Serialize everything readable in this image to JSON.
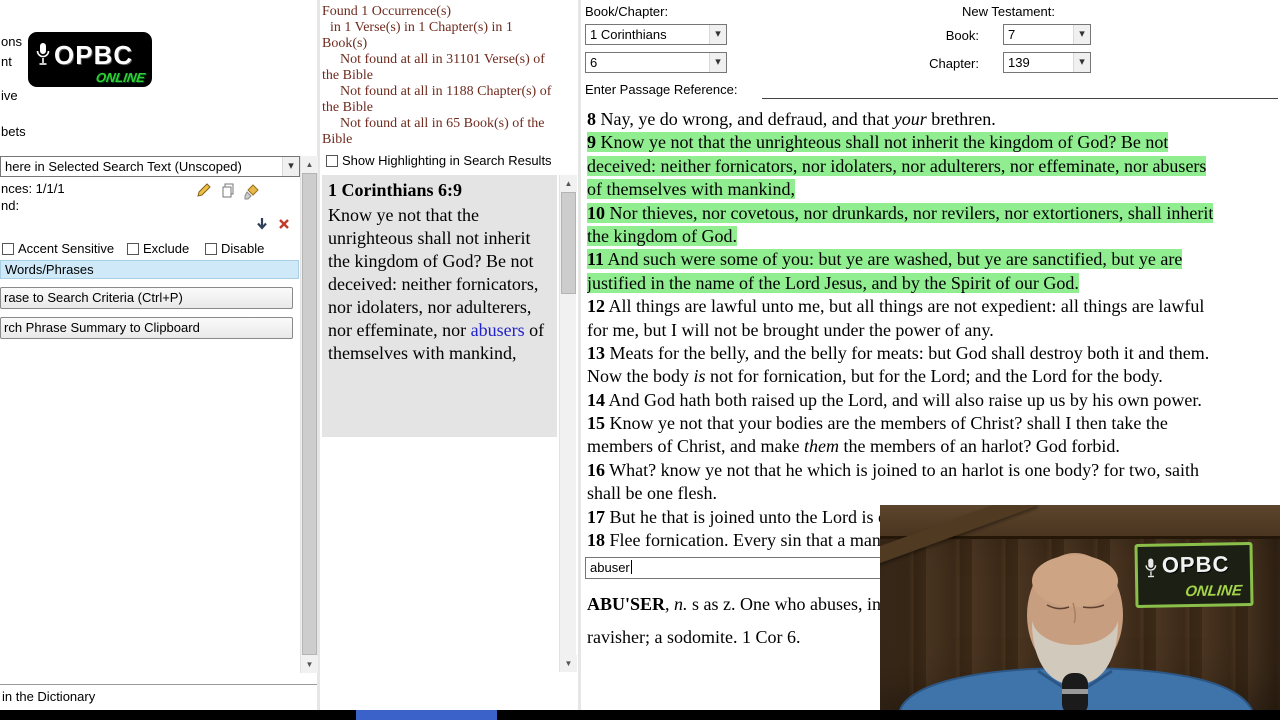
{
  "logo": {
    "brand": "OPBC",
    "sub": "ONLINE"
  },
  "colors": {
    "highlight_green": "#90ee90",
    "link_blue": "#2020cc",
    "stats_maroon": "#6e2b1e",
    "tab_blue_bg": "#cfe9f8",
    "brand_green": "#2fd02f",
    "progress_blue": "#3b62c9"
  },
  "icons": {
    "left_toolbar": [
      "edit-icon",
      "copy-icon",
      "clean-icon",
      "move-down-icon",
      "delete-icon"
    ],
    "combo": "chevron-down-icon",
    "logo": "microphone-icon"
  },
  "left_panel": {
    "clipped_items": [
      "ons",
      "nt",
      "ive",
      "bets"
    ],
    "scope_value": "here in Selected Search Text (Unscoped)",
    "occurrences": "nces: 1/1/1",
    "find": "nd:",
    "options": [
      "Accent Sensitive",
      "Exclude",
      "Disable"
    ],
    "section_tab": "Words/Phrases",
    "button1": "rase to Search Criteria (Ctrl+P)",
    "button2": "rch Phrase Summary to Clipboard",
    "status": "in the Dictionary"
  },
  "results_panel": {
    "stats": [
      "Found 1 Occurrence(s)",
      "in 1 Verse(s) in 1 Chapter(s) in 1 Book(s)",
      "Not found at all in 31101 Verse(s) of the Bible",
      "Not found at all in 1188 Chapter(s) of the Bible",
      "Not found at all in 65 Book(s) of the Bible"
    ],
    "highlight_toggle": "Show Highlighting in Search Results",
    "result_reference": "1 Corinthians 6:9",
    "result_segments": [
      {
        "t": "Know ye not that the unrighteous shall not inherit the kingdom of God? Be not deceived: neither fornicators, nor idolaters, nor adulterers, nor effeminate, nor "
      },
      {
        "link": "abusers"
      },
      {
        "t": " of themselves with mankind,"
      }
    ]
  },
  "bible_panel": {
    "labels": {
      "book_chapter": "Book/Chapter:",
      "new_testament": "New Testament:",
      "book": "Book:",
      "chapter": "Chapter:",
      "passage": "Enter Passage Reference:"
    },
    "selects": {
      "book_name": "1 Corinthians",
      "chapter_name": "6",
      "book_num": "7",
      "chapter_num": "139"
    },
    "lines": [
      {
        "hl": false,
        "segs": [
          {
            "b": "8"
          },
          {
            "t": " Nay, ye do wrong, and defraud, and that "
          },
          {
            "i": "your"
          },
          {
            "t": " brethren."
          }
        ]
      },
      {
        "hl": true,
        "segs": [
          {
            "b": "9"
          },
          {
            "t": " Know ye not that the unrighteous shall not inherit the kingdom of God? Be not"
          }
        ]
      },
      {
        "hl": true,
        "segs": [
          {
            "t": "deceived: neither fornicators, nor idolaters, nor adulterers, nor effeminate, nor abusers"
          }
        ]
      },
      {
        "hl": true,
        "segs": [
          {
            "t": "of themselves with mankind,"
          }
        ]
      },
      {
        "hl": true,
        "segs": [
          {
            "b": "10"
          },
          {
            "t": " Nor thieves, nor covetous, nor drunkards, nor revilers, nor extortioners, shall inherit"
          }
        ]
      },
      {
        "hl": true,
        "segs": [
          {
            "t": "the kingdom of God."
          }
        ]
      },
      {
        "hl": true,
        "segs": [
          {
            "b": "11"
          },
          {
            "t": " And such were some of you: but ye are washed, but ye are sanctified, but ye are"
          }
        ]
      },
      {
        "hl": true,
        "segs": [
          {
            "t": "justified in the name of the Lord Jesus, and by the Spirit of our God."
          }
        ]
      },
      {
        "hl": false,
        "segs": [
          {
            "b": "12"
          },
          {
            "t": " All things are lawful unto me, but all things are not expedient: all things are lawful"
          }
        ]
      },
      {
        "hl": false,
        "segs": [
          {
            "t": "for me, but I will not be brought under the power of any."
          }
        ]
      },
      {
        "hl": false,
        "segs": [
          {
            "b": "13"
          },
          {
            "t": " Meats for the belly, and the belly for meats: but God shall destroy both it and them."
          }
        ]
      },
      {
        "hl": false,
        "segs": [
          {
            "t": "Now the body "
          },
          {
            "i": "is"
          },
          {
            "t": " not for fornication, but for the Lord; and the Lord for the body."
          }
        ]
      },
      {
        "hl": false,
        "segs": [
          {
            "b": "14"
          },
          {
            "t": " And God hath both raised up the Lord, and will also raise up us by his own power."
          }
        ]
      },
      {
        "hl": false,
        "segs": [
          {
            "b": "15"
          },
          {
            "t": " Know ye not that your bodies are the members of Christ? shall I then take the"
          }
        ]
      },
      {
        "hl": false,
        "segs": [
          {
            "t": "members of Christ, and make "
          },
          {
            "i": "them"
          },
          {
            "t": " the members of an harlot? God forbid."
          }
        ]
      },
      {
        "hl": false,
        "segs": [
          {
            "b": "16"
          },
          {
            "t": " What? know ye not that he which is joined to an harlot is one body? for two, saith"
          }
        ]
      },
      {
        "hl": false,
        "segs": [
          {
            "t": "shall be one flesh."
          }
        ]
      },
      {
        "hl": false,
        "segs": [
          {
            "b": "17"
          },
          {
            "t": " But he that is joined unto the Lord is one spirit."
          }
        ]
      },
      {
        "hl": false,
        "segs": [
          {
            "b": "18"
          },
          {
            "t": " Flee fornication. Every sin that a man doeth is without the body; but he that"
          }
        ]
      }
    ]
  },
  "dictionary_panel": {
    "search_value": "abuser",
    "lines": [
      {
        "hl": false,
        "segs": [
          {
            "b": "ABU'SER"
          },
          {
            "t": ", "
          },
          {
            "i": "n."
          },
          {
            "t": " s as z. One who abuses, in speech or behavior; one that deceives; a"
          }
        ]
      },
      {
        "hl": false,
        "segs": [
          {
            "t": "ravisher; a sodomite. 1 Cor 6."
          }
        ]
      }
    ]
  },
  "webcam": {
    "sign_brand": "OPBC",
    "sign_sub": "ONLINE"
  }
}
